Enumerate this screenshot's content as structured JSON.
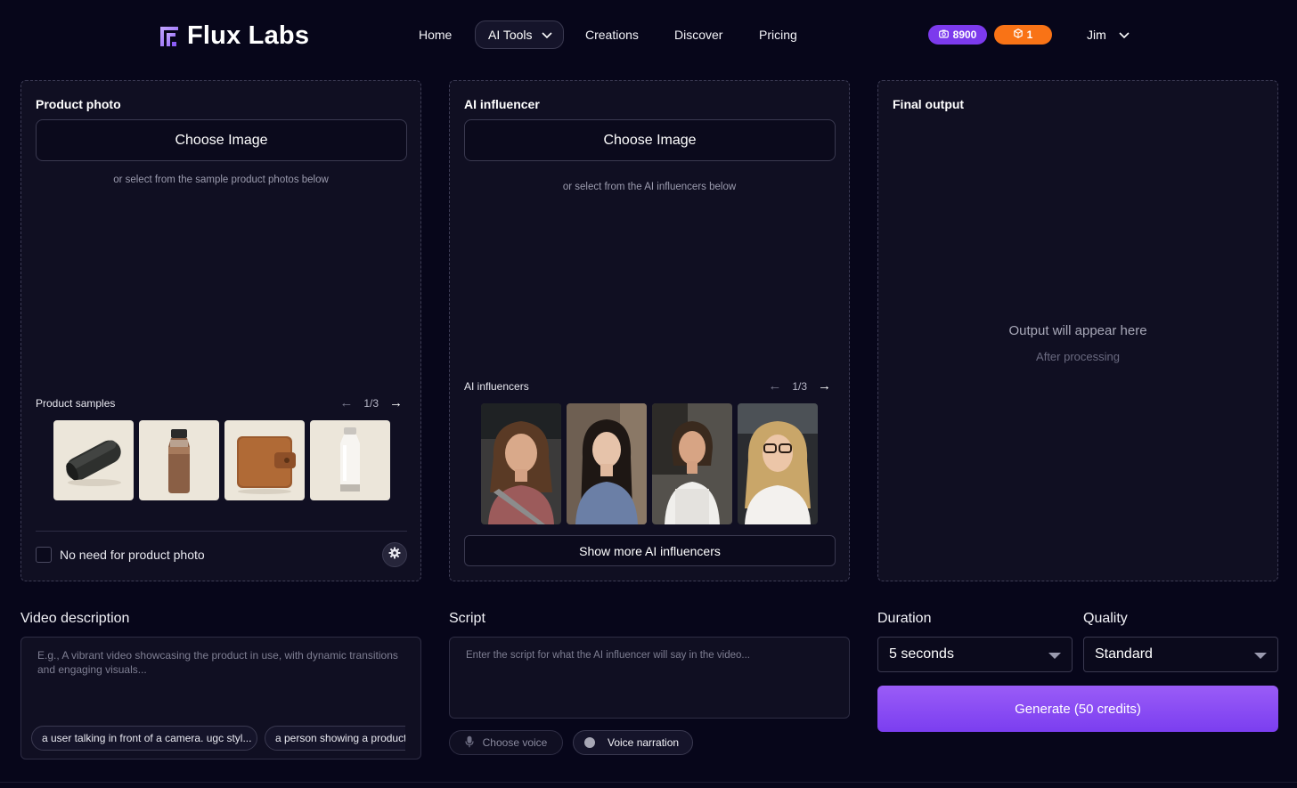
{
  "brand": {
    "name": "Flux Labs"
  },
  "nav": {
    "items": [
      "Home",
      "AI Tools",
      "Creations",
      "Discover",
      "Pricing"
    ]
  },
  "account": {
    "credits": "8900",
    "gems": "1",
    "user_name": "Jim"
  },
  "product_panel": {
    "title": "Product photo",
    "choose_label": "Choose Image",
    "hint": "or select from the sample product photos below",
    "samples_label": "Product samples",
    "pager": "1/3",
    "samples": [
      "speaker-icon",
      "bottle-icon",
      "wallet-icon",
      "flask-icon"
    ],
    "no_photo_label": "No need for product photo"
  },
  "influencer_panel": {
    "title": "AI influencer",
    "choose_label": "Choose Image",
    "hint": "or select from the AI influencers below",
    "list_label": "AI influencers",
    "pager": "1/3",
    "show_more_label": "Show more AI influencers"
  },
  "output_panel": {
    "title": "Final output",
    "placeholder": "Output will appear here",
    "sub": "After processing"
  },
  "video_description": {
    "label": "Video description",
    "placeholder": "E.g., A vibrant video showcasing the product in use, with dynamic transitions and engaging visuals...",
    "chips": [
      "a user talking in front of a camera. ugc styl...",
      "a person showing a product"
    ]
  },
  "script": {
    "label": "Script",
    "placeholder": "Enter the script for what the AI influencer will say in the video...",
    "voice_label": "Choose voice",
    "narration_label": "Voice narration"
  },
  "duration": {
    "label": "Duration",
    "value": "5 seconds"
  },
  "quality": {
    "label": "Quality",
    "value": "Standard"
  },
  "generate_label": "Generate (50 credits)",
  "colors": {
    "background": "#07061a",
    "panel": "#100f22",
    "accent_purple": "#7c3aed",
    "accent_orange": "#f97316"
  }
}
